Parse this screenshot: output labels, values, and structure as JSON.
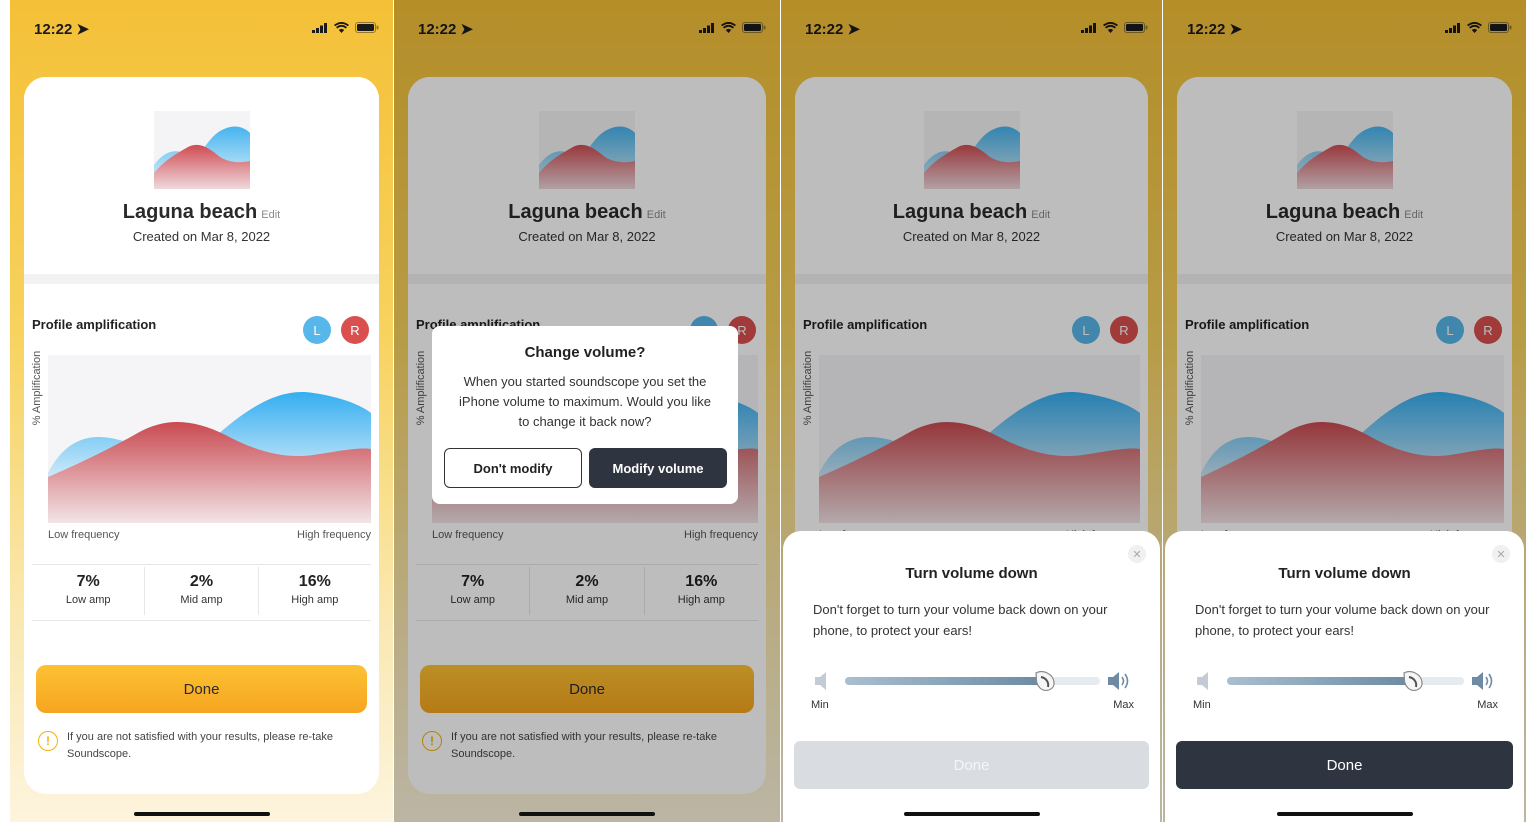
{
  "status": {
    "time": "12:22"
  },
  "profile": {
    "name": "Laguna beach",
    "edit_label": "Edit",
    "created": "Created on Mar 8, 2022"
  },
  "amplification": {
    "title": "Profile amplification",
    "left_chip": "L",
    "right_chip": "R",
    "y_axis_label": "% Amplification",
    "x_low_label": "Low frequency",
    "x_high_label": "High frequency",
    "stats": [
      {
        "value": "7%",
        "label": "Low amp"
      },
      {
        "value": "2%",
        "label": "Mid amp"
      },
      {
        "value": "16%",
        "label": "High amp"
      }
    ]
  },
  "done_label": "Done",
  "note": "If you are not satisfied with your results, please re-take Soundscope.",
  "alert": {
    "title": "Change volume?",
    "message": "When you started soundscope you set the iPhone volume to maximum. Would you like to change it back now?",
    "secondary_label": "Don't modify",
    "primary_label": "Modify volume"
  },
  "sheet": {
    "title": "Turn volume down",
    "message": "Don't forget to turn your volume back down on your phone, to protect your ears!",
    "min_label": "Min",
    "max_label": "Max",
    "close_icon": "close-icon",
    "volume_level": 0.78,
    "done_label": "Done"
  },
  "colors": {
    "brand_yellow": "#f5a51f",
    "dark_button": "#2f3540",
    "left_ear": "#58b7ea",
    "right_ear": "#d9504f"
  }
}
